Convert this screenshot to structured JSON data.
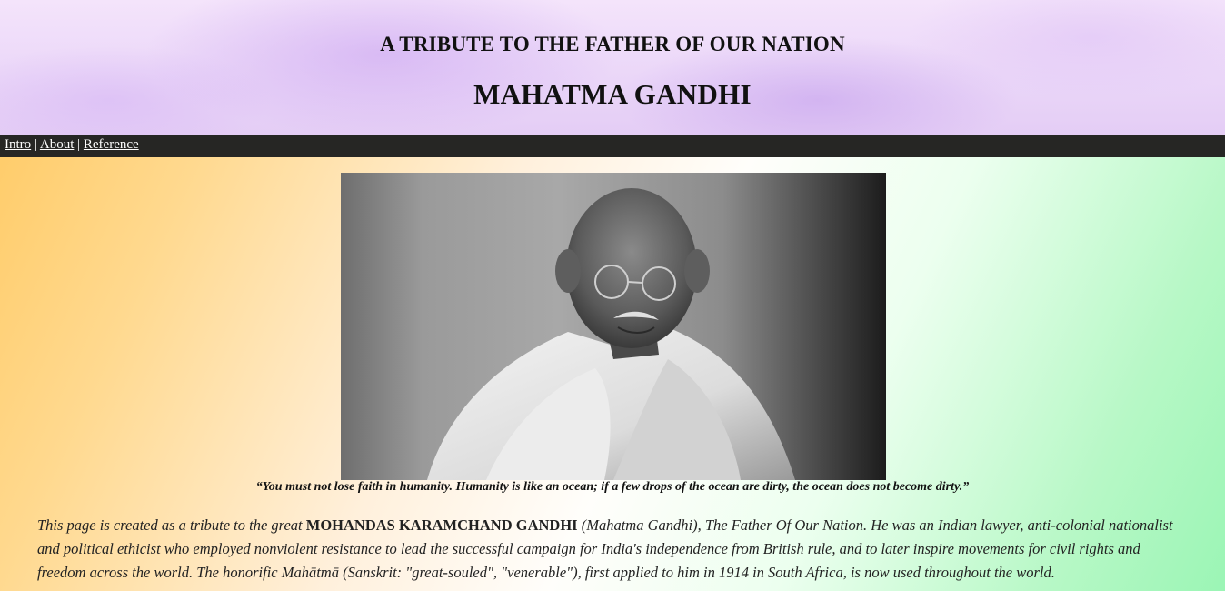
{
  "header": {
    "subtitle": "A TRIBUTE TO THE FATHER OF OUR NATION",
    "title": "MAHATMA GANDHI"
  },
  "nav": {
    "items": [
      {
        "label": "Intro"
      },
      {
        "label": "About"
      },
      {
        "label": "Reference"
      }
    ],
    "separator": "|"
  },
  "main": {
    "quote": "“You must not lose faith in humanity. Humanity is like an ocean; if a few drops of the ocean are dirty, the ocean does not become dirty.”",
    "intro": {
      "text_before": "This page is created as a tribute to the great ",
      "name": "MOHANDAS KARAMCHAND GANDHI",
      "text_open": " (",
      "alias": "Mahatma Gandhi",
      "text_after": "), The Father Of Our Nation. He was an Indian lawyer, anti-colonial nationalist and political ethicist who employed nonviolent resistance to lead the successful campaign for India's independence from British rule, and to later inspire movements for civil rights and freedom across the world. The honorific Mahātmā (Sanskrit: \"great-souled\", \"venerable\"), first applied to him in 1914 in South Africa, is now used throughout the world."
    }
  },
  "colors": {
    "nav_background": "#262624",
    "gradient_saffron": "#ffc85e",
    "gradient_green": "#9bf5b5",
    "header_lavender": "#e4cdf5"
  }
}
